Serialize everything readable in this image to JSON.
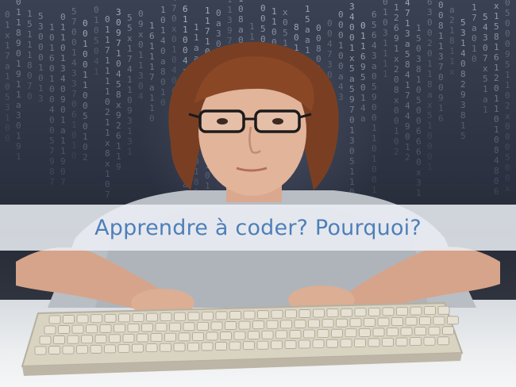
{
  "banner": {
    "title": "Apprendre à coder? Pourquoi?"
  },
  "colors": {
    "banner_text": "#4f7fb8",
    "banner_background": "#ecf0f6",
    "background": "#2b3140",
    "code_rain": "#c9d2e6"
  },
  "image": {
    "subject": "child-at-keyboard-photo",
    "background_motif": "digital-code-rain"
  }
}
